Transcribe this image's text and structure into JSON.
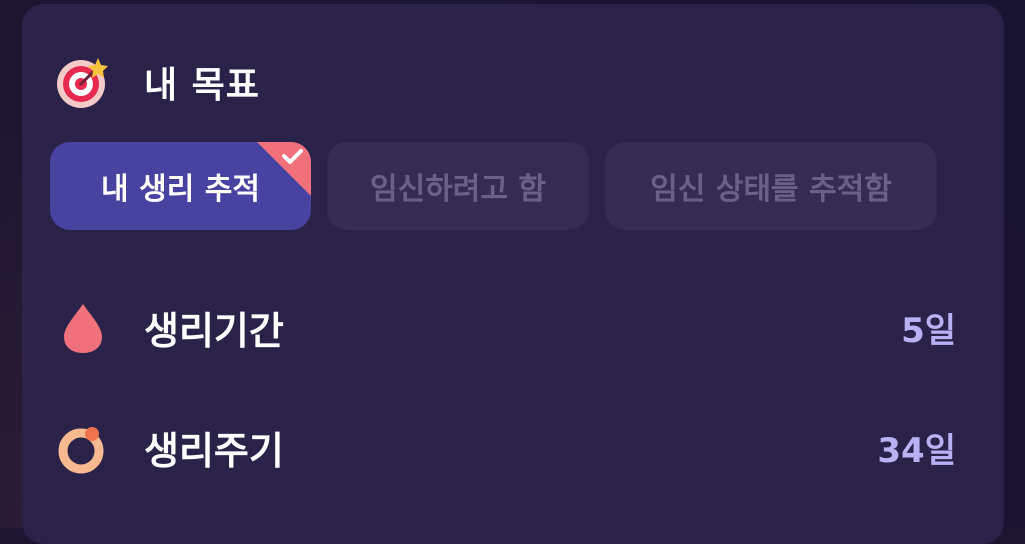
{
  "goal": {
    "title": "내 목표",
    "tabs": [
      {
        "label": "내 생리 추적",
        "selected": true
      },
      {
        "label": "임신하려고 함",
        "selected": false
      },
      {
        "label": "임신 상태를 추적함",
        "selected": false
      }
    ]
  },
  "period": {
    "label": "생리기간",
    "value": "5일"
  },
  "cycle": {
    "label": "생리주기",
    "value": "34일"
  },
  "colors": {
    "accent_active": "#4842a0",
    "check_corner": "#f0707c",
    "value_text": "#b8b2f5"
  }
}
